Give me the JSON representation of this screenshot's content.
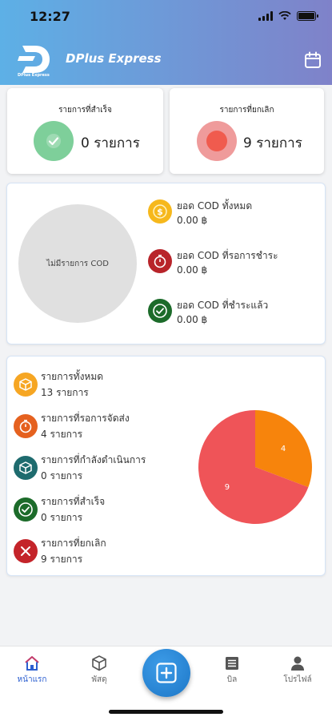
{
  "status_bar": {
    "time": "12:27"
  },
  "header": {
    "app_name": "DPlus Express",
    "logo_subtitle": "DPlus Express",
    "icons": [
      "logo-icon",
      "calendar-icon"
    ]
  },
  "summary": {
    "success": {
      "title": "รายการที่สำเร็จ",
      "value": "0 รายการ",
      "color": "#7ecf9a",
      "icon": "check-circle-icon"
    },
    "cancelled": {
      "title": "รายการที่ยกเลิก",
      "value": "9 รายการ",
      "color": "#ef8f8f",
      "icon": "dot-circle-icon"
    }
  },
  "cod": {
    "pie_empty_label": "ไม่มีรายการ COD",
    "items": [
      {
        "label": "ยอด COD ทั้งหมด",
        "value": "0.00 ฿",
        "color": "#f6b81c",
        "icon": "coin-icon"
      },
      {
        "label": "ยอด COD ที่รอการชำระ",
        "value": "0.00 ฿",
        "color": "#b8242a",
        "icon": "timer-icon"
      },
      {
        "label": "ยอด COD ที่ชำระแล้ว",
        "value": "0.00 ฿",
        "color": "#1c6b2a",
        "icon": "check-circle-icon"
      }
    ]
  },
  "orders": {
    "items": [
      {
        "label": "รายการทั้งหมด",
        "value": "13 รายการ",
        "color": "#f6a623",
        "icon": "box-icon"
      },
      {
        "label": "รายการที่รอการจัดส่ง",
        "value": "4 รายการ",
        "color": "#e5611f",
        "icon": "timer-icon"
      },
      {
        "label": "รายการที่กำลังดำเนินการ",
        "value": "0 รายการ",
        "color": "#1e6b6e",
        "icon": "cube-icon"
      },
      {
        "label": "รายการที่สำเร็จ",
        "value": "0 รายการ",
        "color": "#1c6b2a",
        "icon": "check-circle-icon"
      },
      {
        "label": "รายการที่ยกเลิก",
        "value": "9 รายการ",
        "color": "#c4242a",
        "icon": "x-circle-icon"
      }
    ]
  },
  "chart_data": {
    "type": "pie",
    "categories": [
      "รายการที่รอการจัดส่ง",
      "รายการที่ยกเลิก"
    ],
    "values": [
      4,
      9
    ],
    "data_labels": [
      "4",
      "9"
    ],
    "colors": [
      "#f7840c",
      "#ef5458"
    ]
  },
  "tabbar": {
    "tabs": [
      {
        "label": "หน้าแรก",
        "icon": "home-icon",
        "active": true
      },
      {
        "label": "พัสดุ",
        "icon": "package-icon",
        "active": false
      },
      {
        "label": "บิล",
        "icon": "list-icon",
        "active": false
      },
      {
        "label": "โปรไฟล์",
        "icon": "user-icon",
        "active": false
      }
    ],
    "fab_icon": "plus-icon"
  }
}
